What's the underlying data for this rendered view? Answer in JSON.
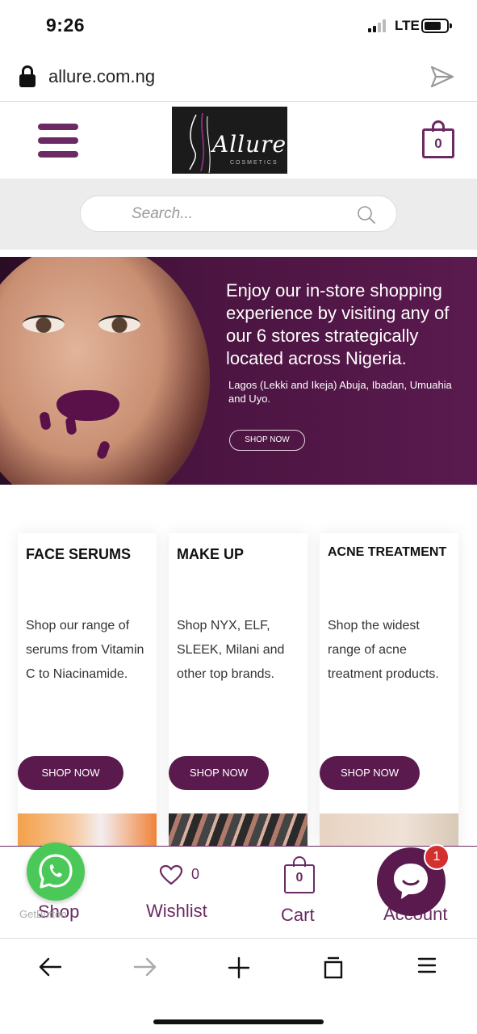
{
  "status": {
    "time": "9:26",
    "network": "LTE"
  },
  "browser": {
    "url": "allure.com.ng"
  },
  "header": {
    "logo_text": "Allure",
    "logo_sub": "COSMETICS",
    "cart_count": "0"
  },
  "search": {
    "placeholder": "Search..."
  },
  "hero": {
    "headline": "Enjoy our in-store shopping experience by visiting any of our 6 stores strategically located across Nigeria.",
    "sub": "Lagos (Lekki and Ikeja) Abuja, Ibadan, Umuahia and Uyo.",
    "button": "SHOP NOW"
  },
  "cards": [
    {
      "title": "FACE SERUMS",
      "desc": "Shop our range of serums from Vitamin C to Niacinamide.",
      "button": "SHOP NOW"
    },
    {
      "title": "MAKE UP",
      "desc": "Shop NYX, ELF, SLEEK, Milani and other top brands.",
      "button": "SHOP NOW"
    },
    {
      "title": "ACNE TREATMENT",
      "desc": "Shop the widest range of acne treatment products.",
      "button": "SHOP NOW"
    }
  ],
  "shopbar": {
    "shop": "Shop",
    "wishlist": "Wishlist",
    "wishlist_count": "0",
    "cart": "Cart",
    "cart_count": "0",
    "account": "Account"
  },
  "widgets": {
    "getbutton": "GetButton",
    "chat_badge": "1"
  },
  "colors": {
    "brand": "#5a1a4e",
    "accent": "#6b2a63",
    "whatsapp": "#4ac959",
    "badge": "#d3312f"
  }
}
